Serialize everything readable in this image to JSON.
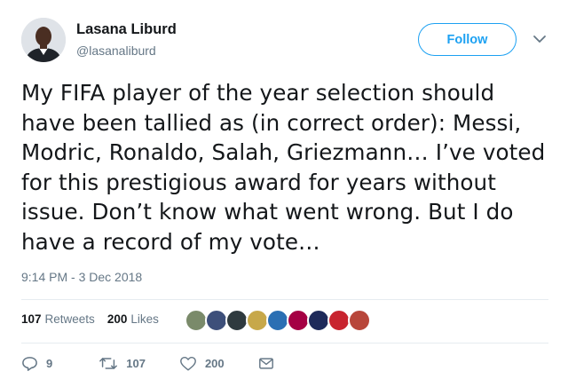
{
  "author": {
    "name": "Lasana Liburd",
    "handle": "@lasanaliburd"
  },
  "follow_label": "Follow",
  "tweet": {
    "text": "My FIFA player of the year selection should have been tallied as (in correct order): Messi, Modric, Ronaldo, Salah, Griezmann… I’ve voted for this prestigious award for years without issue. Don’t know what went wrong. But I do have a record of my vote…",
    "timestamp": "9:14 PM - 3 Dec 2018"
  },
  "stats": {
    "retweets_count": "107",
    "retweets_label": "Retweets",
    "likes_count": "200",
    "likes_label": "Likes"
  },
  "likers": [
    {
      "icon": "liker-avatar",
      "color": "#7a8a6a"
    },
    {
      "icon": "liker-avatar",
      "color": "#3d4f7a"
    },
    {
      "icon": "liker-avatar",
      "color": "#2f3a3f"
    },
    {
      "icon": "liker-avatar",
      "color": "#c7a84a"
    },
    {
      "icon": "liker-avatar",
      "color": "#2b6fb3"
    },
    {
      "icon": "liker-avatar",
      "color": "#a50044"
    },
    {
      "icon": "liker-avatar",
      "color": "#1e2a5a"
    },
    {
      "icon": "liker-avatar",
      "color": "#c8242f"
    },
    {
      "icon": "liker-avatar",
      "color": "#b8463a"
    }
  ],
  "actions": {
    "reply_count": "9",
    "retweet_count": "107",
    "like_count": "200"
  },
  "colors": {
    "accent": "#1da1f2",
    "muted": "#657786",
    "text": "#14171a",
    "divider": "#e6ecf0"
  }
}
